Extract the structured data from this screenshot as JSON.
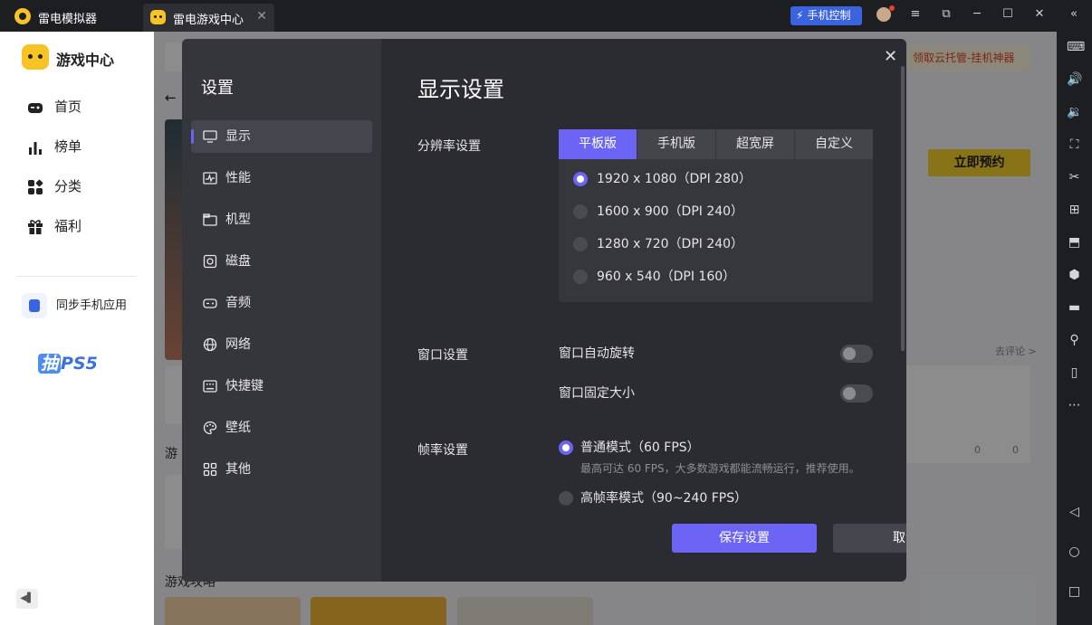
{
  "titlebar": {
    "app_title": "雷电模拟器",
    "tab_label": "雷电游戏中心",
    "tab_close": "✕",
    "phone_control": "手机控制",
    "menu_icon": "≡",
    "minimize": "─",
    "maximize": "☐",
    "close": "✕",
    "collapse": "«"
  },
  "sidebar": {
    "brand": "游戏中心",
    "items": [
      {
        "label": "首页"
      },
      {
        "label": "榜单"
      },
      {
        "label": "分类"
      },
      {
        "label": "福利"
      }
    ],
    "sync_label": "同步手机应用",
    "promo_prefix": "抽",
    "promo_brand": "PS5"
  },
  "background": {
    "promo_banner": "领取云托管-挂机神器",
    "book_button": "立即预约",
    "comment_link": "去评论 >",
    "section1": "游",
    "section2": "游戏攻略",
    "likes": "0",
    "replies": "0"
  },
  "modal": {
    "sidebar_title": "设置",
    "nav": [
      {
        "label": "显示",
        "icon": "monitor-icon"
      },
      {
        "label": "性能",
        "icon": "performance-icon"
      },
      {
        "label": "机型",
        "icon": "device-model-icon"
      },
      {
        "label": "磁盘",
        "icon": "disk-icon"
      },
      {
        "label": "音频",
        "icon": "audio-icon"
      },
      {
        "label": "网络",
        "icon": "globe-icon"
      },
      {
        "label": "快捷键",
        "icon": "keyboard-icon"
      },
      {
        "label": "壁纸",
        "icon": "palette-icon"
      },
      {
        "label": "其他",
        "icon": "grid-icon"
      }
    ],
    "active_nav": "显示",
    "title": "显示设置",
    "resolution": {
      "label": "分辨率设置",
      "tabs": [
        "平板版",
        "手机版",
        "超宽屏",
        "自定义"
      ],
      "active_tab": "平板版",
      "options": [
        "1920 x 1080（DPI 280）",
        "1600 x 900（DPI 240）",
        "1280 x 720（DPI 240）",
        "960 x 540（DPI 160）"
      ],
      "selected": "1920 x 1080（DPI 280）"
    },
    "window": {
      "label": "窗口设置",
      "auto_rotate": "窗口自动旋转",
      "auto_rotate_on": false,
      "fixed_size": "窗口固定大小",
      "fixed_size_on": false
    },
    "fps": {
      "label": "帧率设置",
      "normal": "普通模式（60 FPS）",
      "normal_desc": "最高可达 60 FPS，大多数游戏都能流畅运行，推荐使用。",
      "high": "高帧率模式（90~240 FPS）",
      "selected": "普通模式（60 FPS）"
    },
    "save_button": "保存设置",
    "cancel_button": "取消"
  },
  "colors": {
    "accent": "#6b64f5",
    "brand_yellow": "#f7c325",
    "titlebar_bg": "#1d1e22",
    "modal_bg": "#2b2c31"
  }
}
